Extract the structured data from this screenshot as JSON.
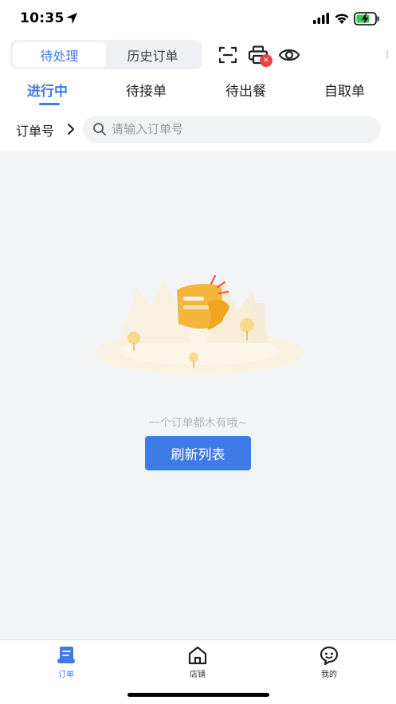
{
  "status_bar": {
    "time": "10:35"
  },
  "header": {
    "segments": {
      "active": "待处理",
      "inactive": "历史订单"
    },
    "icons": [
      "scan-icon",
      "printer-icon",
      "eye-icon"
    ],
    "printer_badge": "×"
  },
  "tabs": [
    {
      "label": "进行中",
      "active": true
    },
    {
      "label": "待接单",
      "active": false
    },
    {
      "label": "待出餐",
      "active": false
    },
    {
      "label": "自取单",
      "active": false
    }
  ],
  "search": {
    "filter_label": "订单号",
    "placeholder": "请输入订单号",
    "value": ""
  },
  "empty_state": {
    "message": "一个订单都木有哦~",
    "button_label": "刷新列表"
  },
  "bottom_nav": [
    {
      "label": "订单",
      "icon": "order-list-icon",
      "active": true
    },
    {
      "label": "店铺",
      "icon": "store-icon",
      "active": false
    },
    {
      "label": "我的",
      "icon": "profile-chat-icon",
      "active": false
    }
  ],
  "colors": {
    "accent": "#3f7be6",
    "badge": "#e64340",
    "background": "#f3f4f6",
    "illustration": "#f5b53d"
  }
}
